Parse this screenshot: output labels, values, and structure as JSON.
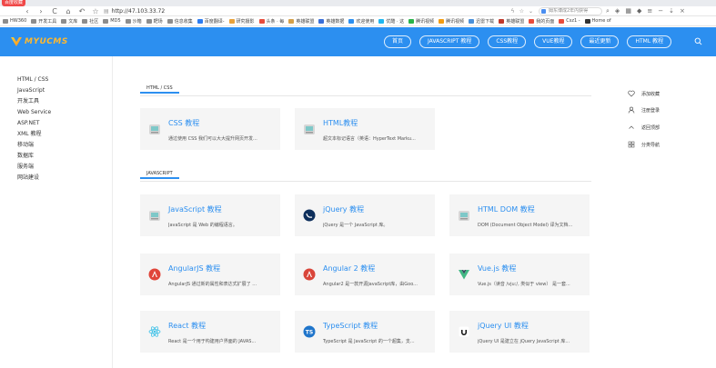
{
  "browser": {
    "tab_badge": "百度收藏",
    "url": "http://47.103.33.72",
    "search_placeholder": "姆东博成2年内获得",
    "nav": {
      "back": "‹",
      "forward": "›",
      "reload": "C",
      "home": "⌂",
      "star": "☆"
    },
    "bookmarks": [
      {
        "label": "HW360",
        "color": "#8d8d8d"
      },
      {
        "label": "开发工具",
        "color": "#8d8d8d"
      },
      {
        "label": "文库",
        "color": "#8d8d8d"
      },
      {
        "label": "社区",
        "color": "#8d8d8d"
      },
      {
        "label": "MD5",
        "color": "#8d8d8d"
      },
      {
        "label": "沙箱",
        "color": "#8d8d8d"
      },
      {
        "label": "靶场",
        "color": "#8d8d8d"
      },
      {
        "label": "信息收集",
        "color": "#8d8d8d"
      },
      {
        "label": "百度翻译-",
        "color": "#2d7cf0"
      },
      {
        "label": "研究摄影",
        "color": "#e9a23b"
      },
      {
        "label": "头条 · 每",
        "color": "#e74c3c"
      },
      {
        "label": "英雄联盟",
        "color": "#d4a04a"
      },
      {
        "label": "英雄数据",
        "color": "#3a6fd8"
      },
      {
        "label": "欢迎使用",
        "color": "#2c8ff0"
      },
      {
        "label": "优酷 · 这",
        "color": "#1fb6f0"
      },
      {
        "label": "腾讯视频",
        "color": "#2ab34a"
      },
      {
        "label": "腾讯视频",
        "color": "#f39c12"
      },
      {
        "label": "迅雷下载",
        "color": "#4a90d9"
      },
      {
        "label": "英雄联盟",
        "color": "#c0392b"
      },
      {
        "label": "我的页面",
        "color": "#e74c3c"
      },
      {
        "label": "Csz1 -",
        "color": "#e74c3c"
      },
      {
        "label": "Home of",
        "color": "#333333"
      }
    ]
  },
  "site": {
    "logo_text": "MYUCMS",
    "nav": [
      {
        "label": "首页"
      },
      {
        "label": "JAVASCRIPT 教程"
      },
      {
        "label": "CSS教程"
      },
      {
        "label": "VUE教程"
      },
      {
        "label": "最近更新"
      },
      {
        "label": "HTML 教程"
      }
    ]
  },
  "sidebar": {
    "items": [
      "HTML / CSS",
      "JavaScript",
      "开发工具",
      "Web Service",
      "ASP.NET",
      "XML 教程",
      "移动端",
      "数据库",
      "服务端",
      "网站建设"
    ]
  },
  "sections": [
    {
      "tab": "HTML / CSS",
      "cards": [
        {
          "title": "CSS 教程",
          "desc": "通过使用 CSS 我们可以大大提升网页开发...",
          "icon": "css-icon"
        },
        {
          "title": "HTML教程",
          "desc": "超文本标记语言（英语：HyperText Marku...",
          "icon": "html-icon"
        }
      ]
    },
    {
      "tab": "JAVASCRIPT",
      "cards": [
        {
          "title": "JavaScript 教程",
          "desc": "JavaScript 是 Web 的编程语言。",
          "icon": "javascript-icon"
        },
        {
          "title": "jQuery 教程",
          "desc": "jQuery 是一个 JavaScript 库。",
          "icon": "jquery-icon"
        },
        {
          "title": "HTML DOM 教程",
          "desc": "DOM (Document Object Model) 译为文档...",
          "icon": "html-dom-icon"
        },
        {
          "title": "AngularJS 教程",
          "desc": "AngularJS 通过新的属性和表达式扩展了 ...",
          "icon": "angularjs-icon"
        },
        {
          "title": "Angular 2 教程",
          "desc": "Angular2 是一款开源JavaScript库，由Goo...",
          "icon": "angular2-icon"
        },
        {
          "title": "Vue.js 教程",
          "desc": "Vue.js（读音 /vjuː/, 类似于 view） 是一套...",
          "icon": "vuejs-icon"
        },
        {
          "title": "React 教程",
          "desc": "React 是一个用于构建用户界面的 JAVAS...",
          "icon": "react-icon"
        },
        {
          "title": "TypeScript 教程",
          "desc": "TypeScript 是 JavaScript 的一个超集，支...",
          "icon": "typescript-icon"
        },
        {
          "title": "jQuery UI 教程",
          "desc": "jQuery UI 是建立在 jQuery JavaScript 库...",
          "icon": "jquery-ui-icon"
        }
      ]
    }
  ],
  "right_sidebar": {
    "items": [
      {
        "label": "添加收藏",
        "icon": "heart-icon"
      },
      {
        "label": "注册登录",
        "icon": "user-icon"
      },
      {
        "label": "返回顶部",
        "icon": "chevron-up-icon"
      },
      {
        "label": "分类导航",
        "icon": "grid-icon"
      }
    ]
  },
  "colors": {
    "brand": "#2c8ff0",
    "logo": "#ffb82e"
  }
}
